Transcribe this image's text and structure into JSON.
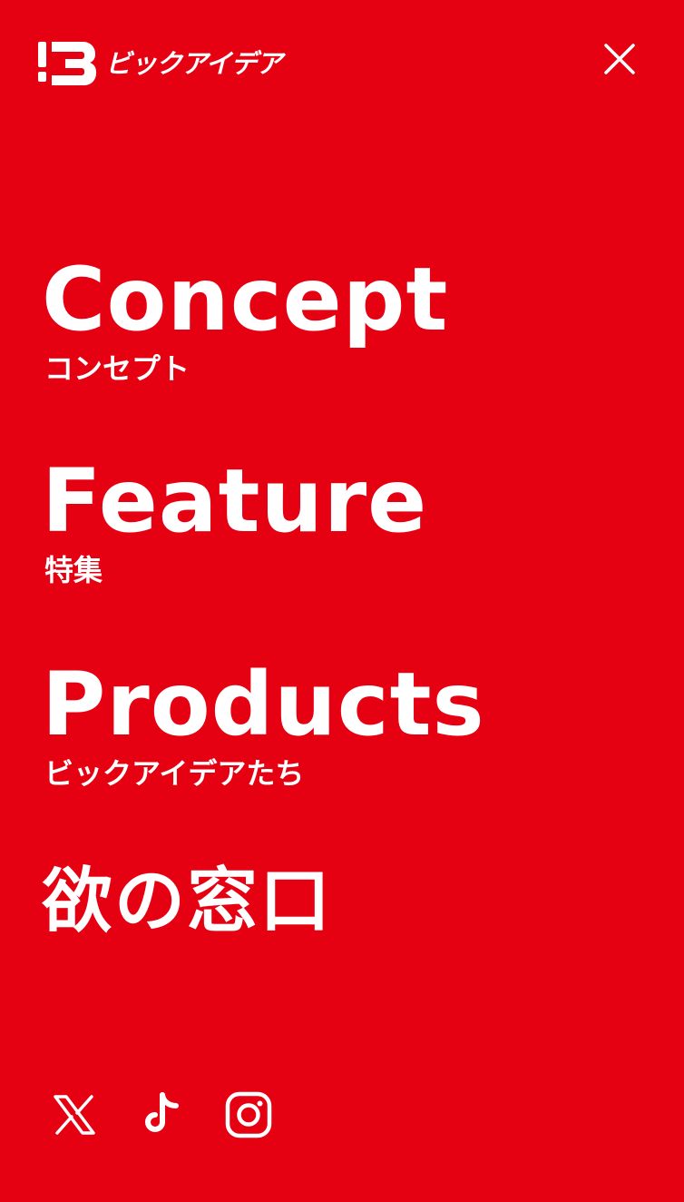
{
  "brand": {
    "name": "ビックアイデア",
    "background_color": "#e50012",
    "foreground_color": "#ffffff"
  },
  "header": {
    "logo_icon": "big-idea-logo-mark",
    "close_icon": "close-icon",
    "close_label": "×"
  },
  "nav": {
    "items": [
      {
        "title": "Concept",
        "subtitle": "コンセプト"
      },
      {
        "title": "Feature",
        "subtitle": "特集"
      },
      {
        "title": "Products",
        "subtitle": "ビックアイデアたち"
      },
      {
        "title": "欲の窓口"
      }
    ]
  },
  "social": {
    "items": [
      {
        "icon": "x-icon"
      },
      {
        "icon": "tiktok-icon"
      },
      {
        "icon": "instagram-icon"
      }
    ]
  }
}
